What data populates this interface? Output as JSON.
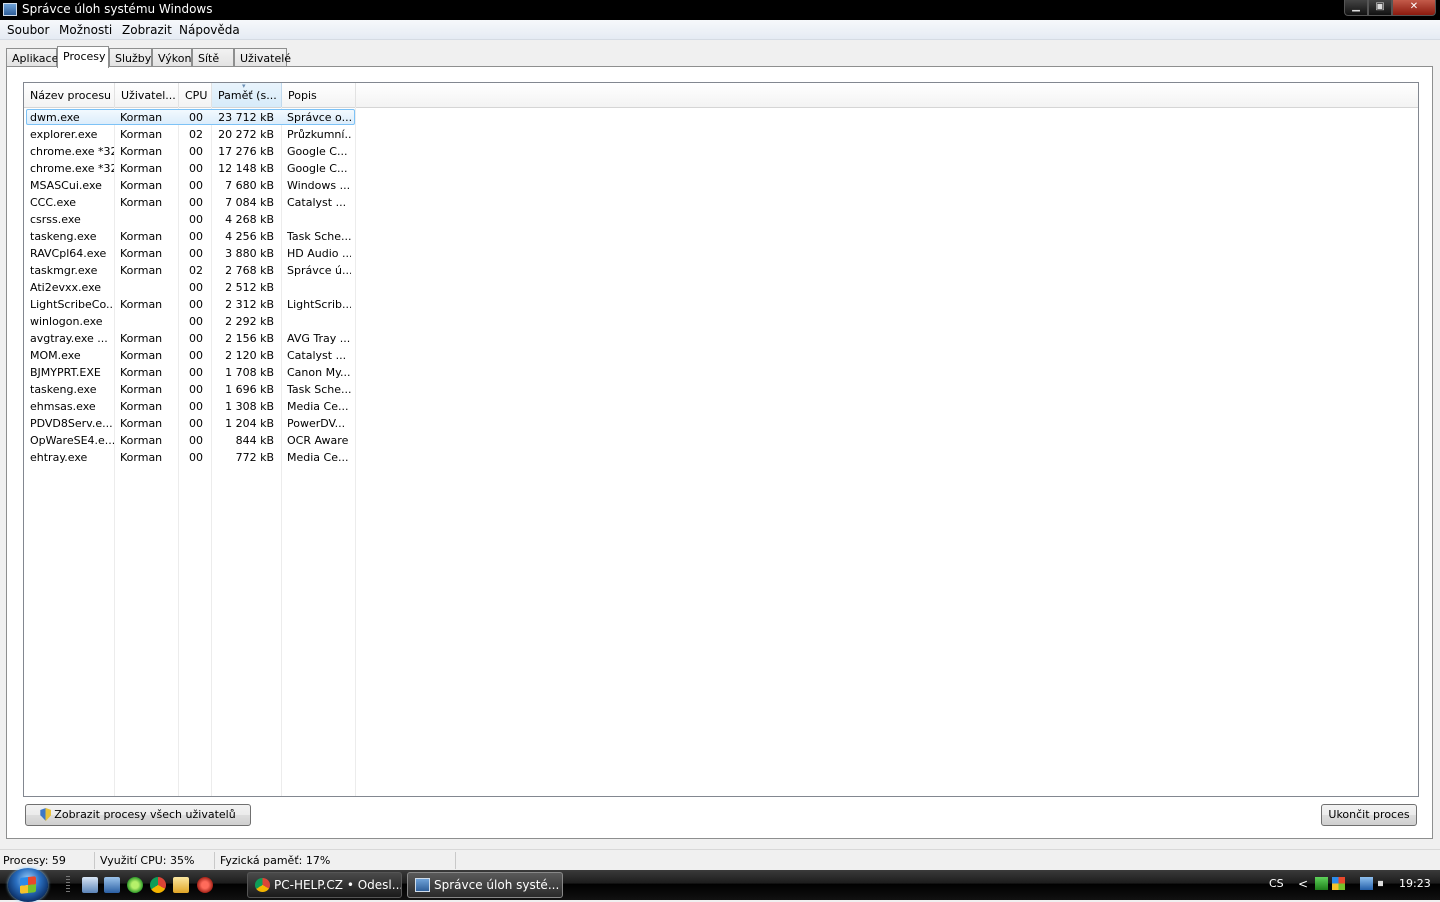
{
  "window": {
    "title": "Správce úloh systému Windows",
    "controls": {
      "minimize": "▁",
      "maximize": "▣",
      "close": "✕"
    }
  },
  "menu": [
    "Soubor",
    "Možnosti",
    "Zobrazit",
    "Nápověda"
  ],
  "tabs": [
    "Aplikace",
    "Procesy",
    "Služby",
    "Výkon",
    "Sítě",
    "Uživatelé"
  ],
  "active_tab": "Procesy",
  "columns": [
    "Název procesu",
    "Uživatel...",
    "CPU",
    "Paměť (s...",
    "Popis"
  ],
  "sorted_column": "Paměť (s...",
  "processes": [
    {
      "name": "dwm.exe",
      "user": "Korman",
      "cpu": "00",
      "memory": "23 712 kB",
      "description": "Správce o..."
    },
    {
      "name": "explorer.exe",
      "user": "Korman",
      "cpu": "02",
      "memory": "20 272 kB",
      "description": "Průzkumní..."
    },
    {
      "name": "chrome.exe *32",
      "user": "Korman",
      "cpu": "00",
      "memory": "17 276 kB",
      "description": "Google C..."
    },
    {
      "name": "chrome.exe *32",
      "user": "Korman",
      "cpu": "00",
      "memory": "12 148 kB",
      "description": "Google C..."
    },
    {
      "name": "MSASCui.exe",
      "user": "Korman",
      "cpu": "00",
      "memory": "7 680 kB",
      "description": "Windows ..."
    },
    {
      "name": "CCC.exe",
      "user": "Korman",
      "cpu": "00",
      "memory": "7 084 kB",
      "description": "Catalyst ..."
    },
    {
      "name": "csrss.exe",
      "user": "",
      "cpu": "00",
      "memory": "4 268 kB",
      "description": ""
    },
    {
      "name": "taskeng.exe",
      "user": "Korman",
      "cpu": "00",
      "memory": "4 256 kB",
      "description": "Task Sche..."
    },
    {
      "name": "RAVCpl64.exe",
      "user": "Korman",
      "cpu": "00",
      "memory": "3 880 kB",
      "description": "HD Audio ..."
    },
    {
      "name": "taskmgr.exe",
      "user": "Korman",
      "cpu": "02",
      "memory": "2 768 kB",
      "description": "Správce ú..."
    },
    {
      "name": "Ati2evxx.exe",
      "user": "",
      "cpu": "00",
      "memory": "2 512 kB",
      "description": ""
    },
    {
      "name": "LightScribeCo...",
      "user": "Korman",
      "cpu": "00",
      "memory": "2 312 kB",
      "description": "LightScrib..."
    },
    {
      "name": "winlogon.exe",
      "user": "",
      "cpu": "00",
      "memory": "2 292 kB",
      "description": ""
    },
    {
      "name": "avgtray.exe ...",
      "user": "Korman",
      "cpu": "00",
      "memory": "2 156 kB",
      "description": "AVG Tray ..."
    },
    {
      "name": "MOM.exe",
      "user": "Korman",
      "cpu": "00",
      "memory": "2 120 kB",
      "description": "Catalyst ..."
    },
    {
      "name": "BJMYPRT.EXE",
      "user": "Korman",
      "cpu": "00",
      "memory": "1 708 kB",
      "description": "Canon My..."
    },
    {
      "name": "taskeng.exe",
      "user": "Korman",
      "cpu": "00",
      "memory": "1 696 kB",
      "description": "Task Sche..."
    },
    {
      "name": "ehmsas.exe",
      "user": "Korman",
      "cpu": "00",
      "memory": "1 308 kB",
      "description": "Media Ce..."
    },
    {
      "name": "PDVD8Serv.e...",
      "user": "Korman",
      "cpu": "00",
      "memory": "1 204 kB",
      "description": "PowerDV..."
    },
    {
      "name": "OpWareSE4.e...",
      "user": "Korman",
      "cpu": "00",
      "memory": "844 kB",
      "description": "OCR Aware"
    },
    {
      "name": "ehtray.exe",
      "user": "Korman",
      "cpu": "00",
      "memory": "772 kB",
      "description": "Media Ce..."
    }
  ],
  "selected_process": "dwm.exe",
  "buttons": {
    "show_all": "Zobrazit procesy všech uživatelů",
    "end_process": "Ukončit proces"
  },
  "status": {
    "processes": "Procesy: 59",
    "cpu": "Využití CPU: 35%",
    "memory": "Fyzická paměť: 17%"
  },
  "taskbar": {
    "tasks": [
      {
        "label": "PC-HELP.CZ • Odesl...",
        "icon": "chrome-icon"
      },
      {
        "label": "Správce úloh systé...",
        "icon": "task-manager-icon"
      }
    ],
    "tray": {
      "language": "CS",
      "chevron": "<",
      "clock": "19:23"
    }
  },
  "colors": {
    "selection_border": "#7dc2f6",
    "selection_fill": "#dcedfb",
    "taskbar": "#000000"
  }
}
